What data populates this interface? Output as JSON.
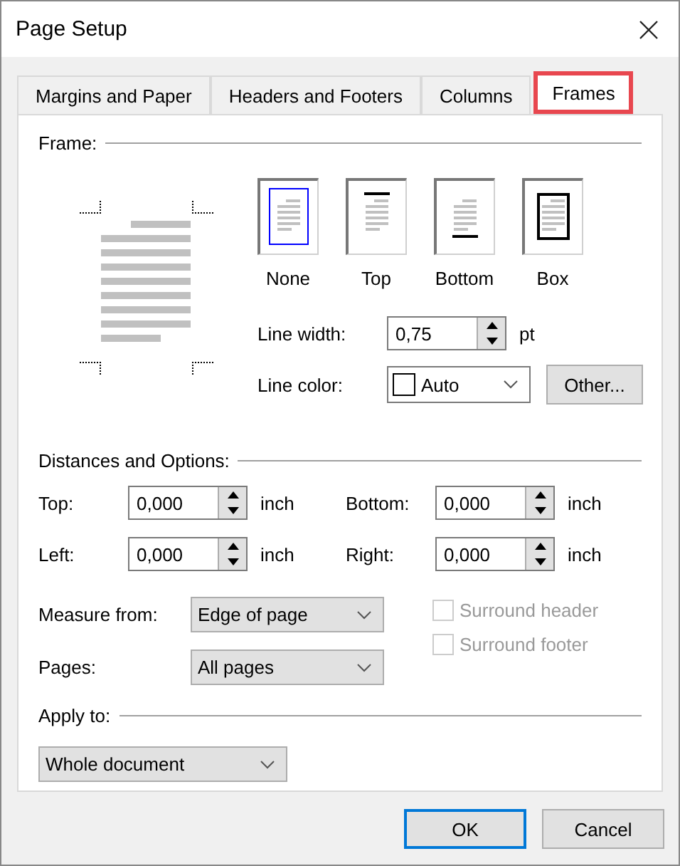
{
  "window": {
    "title": "Page Setup"
  },
  "tabs": [
    {
      "label": "Margins and Paper",
      "selected": false
    },
    {
      "label": "Headers and Footers",
      "selected": false
    },
    {
      "label": "Columns",
      "selected": false
    },
    {
      "label": "Frames",
      "selected": true
    }
  ],
  "frame": {
    "heading": "Frame:",
    "presets": [
      {
        "kind": "none",
        "label": "None",
        "selected": true
      },
      {
        "kind": "top",
        "label": "Top",
        "selected": false
      },
      {
        "kind": "bottom",
        "label": "Bottom",
        "selected": false
      },
      {
        "kind": "box",
        "label": "Box",
        "selected": false
      }
    ],
    "line_width": {
      "label": "Line width:",
      "value": "0,75",
      "unit": "pt"
    },
    "line_color": {
      "label": "Line color:",
      "value": "Auto"
    },
    "other_button": "Other..."
  },
  "distances": {
    "heading": "Distances and Options:",
    "fields": [
      {
        "label": "Top:",
        "value": "0,000",
        "unit": "inch"
      },
      {
        "label": "Bottom:",
        "value": "0,000",
        "unit": "inch"
      },
      {
        "label": "Left:",
        "value": "0,000",
        "unit": "inch"
      },
      {
        "label": "Right:",
        "value": "0,000",
        "unit": "inch"
      }
    ],
    "measure_from": {
      "label": "Measure from:",
      "value": "Edge of page"
    },
    "pages": {
      "label": "Pages:",
      "value": "All pages"
    },
    "options": [
      {
        "label": "Surround header",
        "checked": false,
        "disabled": true
      },
      {
        "label": "Surround footer",
        "checked": false,
        "disabled": true
      }
    ]
  },
  "apply_to": {
    "heading": "Apply to:",
    "value": "Whole document"
  },
  "buttons": [
    {
      "label": "OK",
      "default": true
    },
    {
      "label": "Cancel",
      "default": false
    }
  ]
}
